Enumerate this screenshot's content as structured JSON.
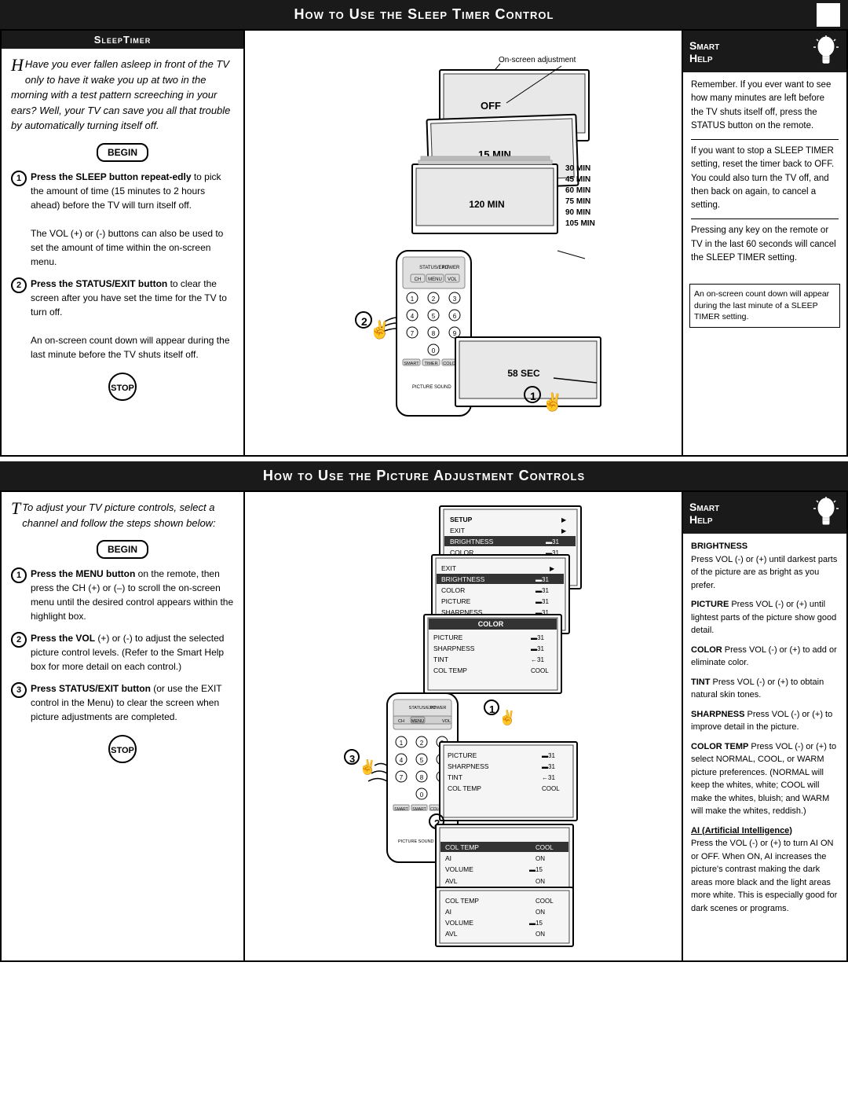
{
  "section1": {
    "title": "How to Use the Sleep Timer  Control",
    "left_panel": {
      "title": "SleepTimer",
      "intro": "Have you ever fallen asleep in front of the TV only to have it wake you up at two in the morning with a test pattern screeching in your ears? Well, your TV can save you all that trouble by automatically turning itself off.",
      "begin_label": "BEGIN",
      "stop_label": "STOP",
      "step1_title": "Press the SLEEP button repeat-edly",
      "step1_body": " to pick the amount of time (15 minutes to 2 hours ahead) before the TV will turn itself off.",
      "step1_extra": "The VOL (+) or (-) buttons can also be used to set the amount of time within the on-screen menu.",
      "step2_title": "Press the STATUS/EXIT button",
      "step2_body": " to clear the screen after you have set the time for the TV to turn off.",
      "step2_extra": "An on-screen count down will appear during the last minute before the TV shuts itself off."
    },
    "right_panel": {
      "smart_label": "Smart",
      "help_label": "Help",
      "p1": "Remember.  If you ever want to see how many minutes are left before the TV shuts itself off, press the STATUS button on the remote.",
      "p2": "If you want to stop a SLEEP TIMER setting, reset the timer back to OFF. You could also turn the TV off, and then back on again, to cancel a setting.",
      "p3": "Pressing any key on the remote or TV in the last 60 seconds will cancel the SLEEP TIMER setting.",
      "footnote": "An on-screen count down will appear during the last minute of a SLEEP TIMER setting."
    },
    "screen_labels": {
      "off": "OFF",
      "min15": "15 MIN",
      "min30": "30 MIN",
      "min45": "45 MIN",
      "min60": "60 MIN",
      "min75": "75 MIN",
      "min90": "90 MIN",
      "min105": "105 MIN",
      "min120": "120 MIN",
      "sec58": "58 SEC",
      "on_screen": "On-screen adjustment"
    }
  },
  "section2": {
    "title": "How to Use the Picture Adjustment Controls",
    "left_panel": {
      "intro": "To adjust your TV picture controls, select a channel and follow the steps shown below:",
      "begin_label": "BEGIN",
      "stop_label": "STOP",
      "step1_title": "Press the MENU button",
      "step1_body": " on the remote, then press the CH (+) or (–) to scroll the on-screen menu until the desired control appears within the highlight box.",
      "step2_title": "Press the VOL",
      "step2_body": " (+) or (-) to adjust the selected picture control levels. (Refer to the Smart Help box for more detail on each control.)",
      "step3_title": "Press STATUS/EXIT button",
      "step3_body": " (or use the EXIT control in the Menu) to clear the screen when picture adjustments are completed."
    },
    "right_panel": {
      "smart_label": "Smart",
      "help_label": "Help",
      "brightness_title": "BRIGHTNESS",
      "brightness_body": "Press VOL (-) or (+) until darkest parts of the picture are as bright as you prefer.",
      "picture_title": "PICTURE",
      "picture_body": "Press VOL (-) or (+) until lightest parts of the picture show good detail.",
      "color_title": "COLOR",
      "color_body": "Press VOL (-) or (+) to add or eliminate color.",
      "tint_title": "TINT",
      "tint_body": "Press VOL (-) or (+) to obtain natural skin tones.",
      "sharpness_title": "SHARPNESS",
      "sharpness_body": "Press VOL (-) or (+) to improve detail in the picture.",
      "colortemp_title": "COLOR TEMP",
      "colortemp_body": "Press VOL (-) or (+) to select NORMAL, COOL, or WARM picture preferences. (NORMAL will keep the whites, white; COOL will make the whites, bluish; and WARM will make the whites, reddish.)",
      "ai_title": "AI (Artificial Intelligence)",
      "ai_body": "Press the VOL (-) or (+) to turn AI ON or OFF. When ON, AI increases the picture's contrast making the dark areas more black and the light areas more white. This is especially good for dark scenes or programs."
    },
    "screens": {
      "s1_setup": "SETUP",
      "s1_exit": "EXIT",
      "s1_brightness": "BRIGHTNESS",
      "s1_brightness_val": "▬31",
      "s1_color": "COLOR",
      "s1_color_val": "▬31",
      "s1_picture": "PICTURE",
      "s1_picture_val": "▬31",
      "color_label": "COLOR"
    }
  }
}
